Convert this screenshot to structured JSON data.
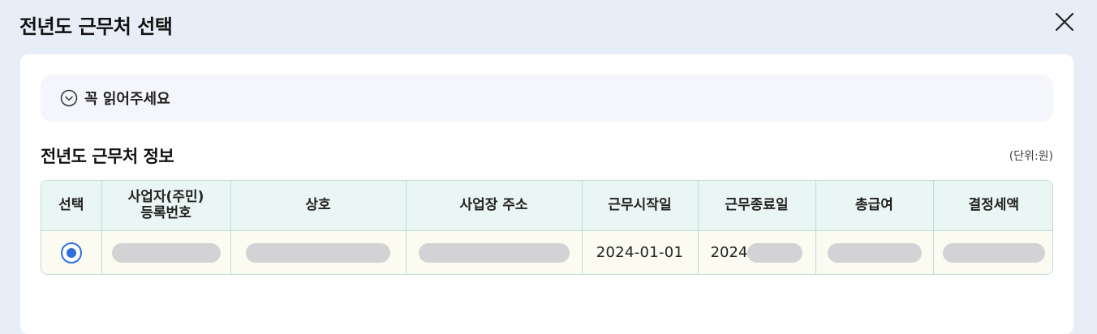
{
  "modal": {
    "title": "전년도 근무처 선택"
  },
  "notice": {
    "label": "꼭 읽어주세요"
  },
  "section": {
    "title": "전년도 근무처 정보",
    "unit": "(단위:원)"
  },
  "table": {
    "headers": [
      "선택",
      "사업자(주민)\n등록번호",
      "상호",
      "사업장 주소",
      "근무시작일",
      "근무종료일",
      "총급여",
      "결정세액"
    ],
    "rows": [
      {
        "selected": true,
        "start_date": "2024-01-01",
        "end_date_visible": "2024"
      }
    ]
  },
  "icons": {
    "close": "close-icon",
    "notice": "chevron-down-circle-icon"
  },
  "colors": {
    "accent": "#2f6fe0",
    "header_bg": "#eaf6f4",
    "row_bg": "#fbfbf1",
    "page_bg": "#e8eef7"
  }
}
